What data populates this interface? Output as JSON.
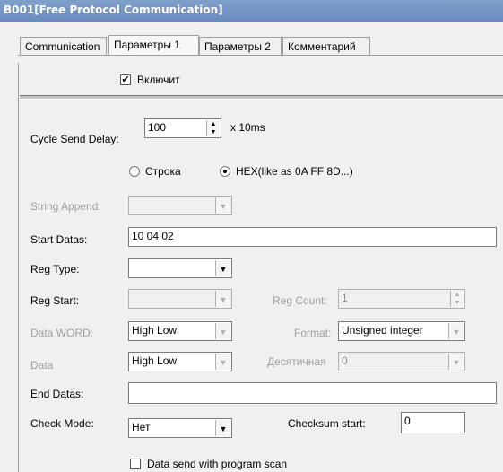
{
  "window": {
    "title": "B001[Free Protocol Communication]"
  },
  "tabs": [
    "Communication",
    "Параметры 1",
    "Параметры 2",
    "Комментарий"
  ],
  "enable": {
    "label": "Включит",
    "checked": true
  },
  "cycle": {
    "label": "Cycle Send Delay:",
    "value": "100",
    "unit": "x 10ms"
  },
  "mode": {
    "option1": "Строка",
    "option2": "HEX(like as 0A FF 8D...)",
    "selected": "option2"
  },
  "string_append": {
    "label": "String Append:",
    "value": ""
  },
  "start_datas": {
    "label": "Start Datas:",
    "value": "10 04 02"
  },
  "reg_type": {
    "label": "Reg Type:",
    "value": ""
  },
  "reg_start": {
    "label": "Reg Start:",
    "value": ""
  },
  "reg_count": {
    "label": "Reg Count:",
    "value": "1"
  },
  "data_word": {
    "label": "Data WORD:",
    "value": "High Low"
  },
  "format": {
    "label": "Format:",
    "value": "Unsigned integer"
  },
  "data": {
    "label": "Data",
    "value": "High Low"
  },
  "decimal": {
    "label": "Десятичная",
    "value": "0"
  },
  "end_datas": {
    "label": "End Datas:",
    "value": ""
  },
  "check_mode": {
    "label": "Check Mode:",
    "value": "Нет"
  },
  "checksum_start": {
    "label": "Checksum start:",
    "value": "0"
  },
  "data_send": {
    "label": "Data send with program scan",
    "checked": false
  },
  "icons": {
    "check": "✔",
    "dropdown": "▼",
    "up": "▲",
    "down": "▼"
  }
}
